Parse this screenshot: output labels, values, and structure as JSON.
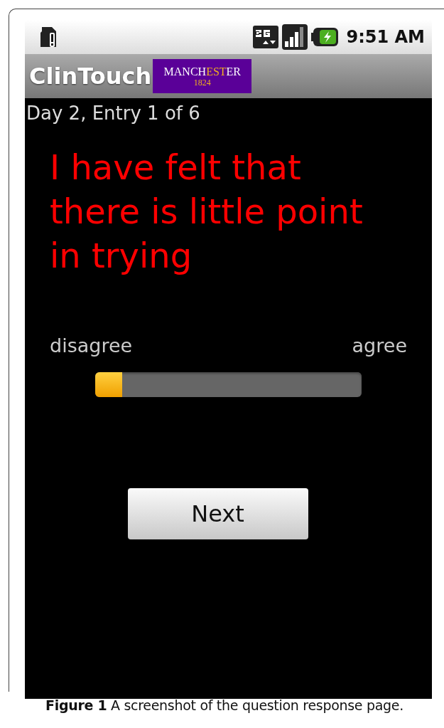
{
  "status_bar": {
    "time": "9:51 AM"
  },
  "title_bar": {
    "app_name": "ClinTouch",
    "logo": {
      "parts": [
        {
          "text": "MANCH",
          "highlight": false
        },
        {
          "text": "EST",
          "highlight": true
        },
        {
          "text": "ER",
          "highlight": false
        }
      ],
      "year": "1824"
    }
  },
  "entry_label": "Day 2, Entry 1 of 6",
  "question": "I have felt that there is little point in trying",
  "scale": {
    "min_label": "disagree",
    "max_label": "agree",
    "level": 0.1
  },
  "buttons": [
    "Next"
  ],
  "caption": "**Figure 1** A screenshot of the question response page."
}
